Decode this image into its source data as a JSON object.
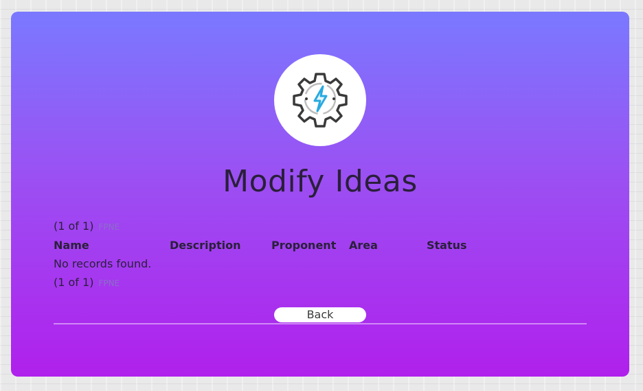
{
  "page": {
    "title": "Modify Ideas"
  },
  "icons": {
    "logo": "gear-lightning-icon"
  },
  "paginator": {
    "summary": "(1 of 1)",
    "first_label": "FPNE"
  },
  "table": {
    "columns": [
      "Name",
      "Description",
      "Proponent",
      "Area",
      "Status"
    ],
    "rows": [],
    "empty_message": "No records found."
  },
  "actions": {
    "back_label": "Back"
  },
  "colors": {
    "gradient_top": "#7a79ff",
    "gradient_bottom": "#b020ec",
    "text": "#2a1f3a",
    "icon_dark": "#3a3a3a",
    "icon_accent": "#29a9e0"
  }
}
